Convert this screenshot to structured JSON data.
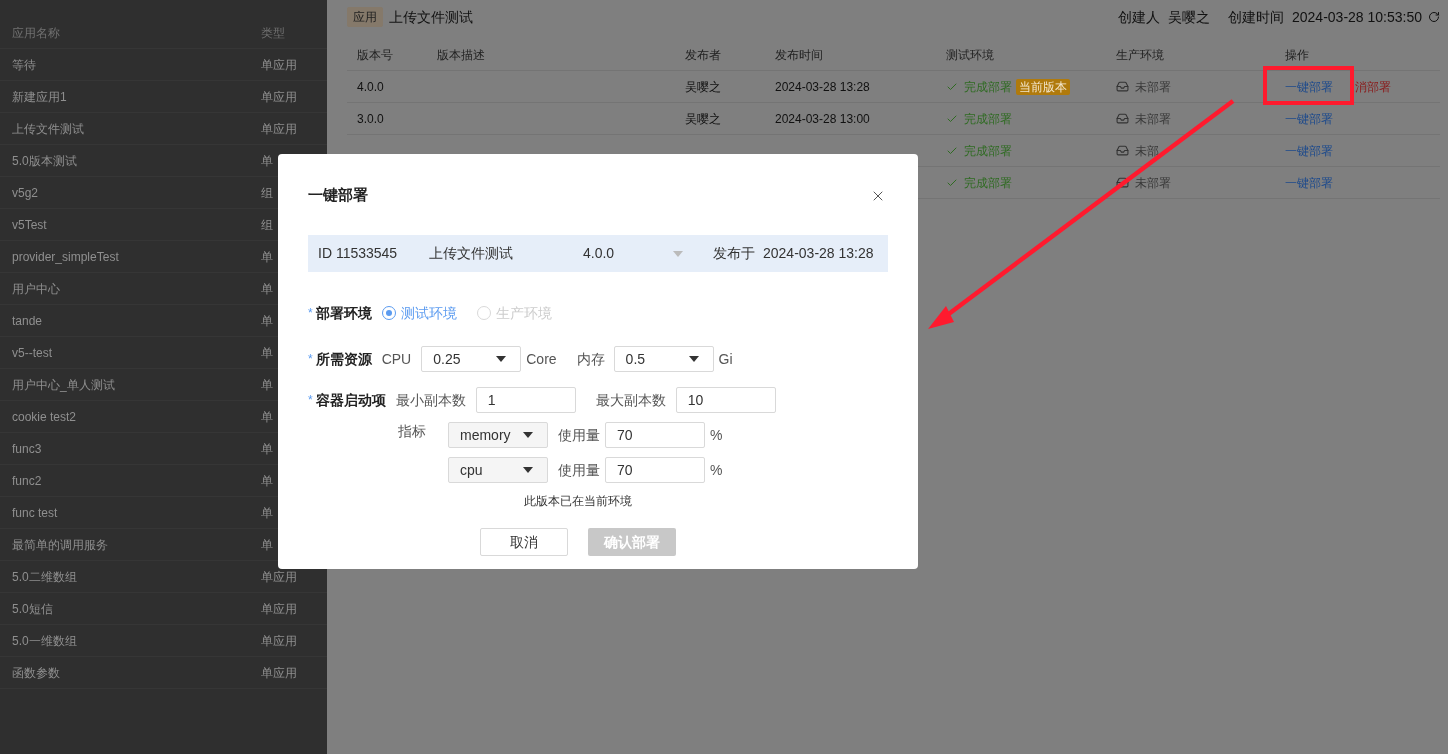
{
  "sidebar": {
    "columns": [
      "应用名称",
      "类型"
    ],
    "rows": [
      {
        "name": "等待",
        "type": "单应用"
      },
      {
        "name": "新建应用1",
        "type": "单应用"
      },
      {
        "name": "上传文件测试",
        "type": "单应用"
      },
      {
        "name": "5.0版本测试",
        "type": "单"
      },
      {
        "name": "v5g2",
        "type": "组"
      },
      {
        "name": "v5Test",
        "type": "组"
      },
      {
        "name": "provider_simpleTest",
        "type": "单"
      },
      {
        "name": "用户中心",
        "type": "单"
      },
      {
        "name": "tande",
        "type": "单"
      },
      {
        "name": "v5--test",
        "type": "单"
      },
      {
        "name": "用户中心_单人测试",
        "type": "单"
      },
      {
        "name": "cookie test2",
        "type": "单"
      },
      {
        "name": "func3",
        "type": "单"
      },
      {
        "name": "func2",
        "type": "单"
      },
      {
        "name": "func test",
        "type": "单"
      },
      {
        "name": "最简单的调用服务",
        "type": "单"
      },
      {
        "name": "5.0二维数组",
        "type": "单应用"
      },
      {
        "name": "5.0短信",
        "type": "单应用"
      },
      {
        "name": "5.0一维数组",
        "type": "单应用"
      },
      {
        "name": "函数参数",
        "type": "单应用"
      }
    ]
  },
  "header": {
    "tag": "应用",
    "title": "上传文件测试",
    "creator_label": "创建人",
    "creator": "吴嘤之",
    "created_label": "创建时间",
    "created_time": "2024-03-28 10:53:50"
  },
  "table": {
    "columns": [
      "版本号",
      "版本描述",
      "发布者",
      "发布时间",
      "测试环境",
      "生产环境",
      "操作"
    ],
    "rows": [
      {
        "version": "4.0.0",
        "publisher": "吴嘤之",
        "time": "2024-03-28 13:28",
        "test_env": "完成部署",
        "current_tag": "当前版本",
        "prod_env": "未部署",
        "actions": [
          {
            "label": "一键部署",
            "kind": "link"
          },
          {
            "label": "消部署",
            "kind": "danger"
          }
        ]
      },
      {
        "version": "3.0.0",
        "publisher": "吴嘤之",
        "time": "2024-03-28 13:00",
        "test_env": "完成部署",
        "prod_env": "未部署",
        "actions": [
          {
            "label": "一键部署",
            "kind": "link"
          }
        ]
      },
      {
        "test_env": "完成部署",
        "prod_env": "未部",
        "actions": [
          {
            "label": "一键部署",
            "kind": "link"
          }
        ]
      },
      {
        "test_env": "完成部署",
        "prod_env": "未部署",
        "actions": [
          {
            "label": "一键部署",
            "kind": "link"
          }
        ]
      }
    ]
  },
  "dialog": {
    "title": "一键部署",
    "info": {
      "id": "ID 11533545",
      "app": "上传文件测试",
      "version": "4.0.0",
      "published_label": "发布于",
      "published_time": "2024-03-28 13:28"
    },
    "environment": {
      "required_mark": "*",
      "label": "部署环境",
      "options": [
        {
          "label": "测试环境",
          "selected": true,
          "disabled": false
        },
        {
          "label": "生产环境",
          "selected": false,
          "disabled": true
        }
      ]
    },
    "resources": {
      "required_mark": "*",
      "label": "所需资源",
      "cpu_label": "CPU",
      "cpu_value": "0.25",
      "cpu_unit": "Core",
      "memory_label": "内存",
      "memory_value": "0.5",
      "memory_unit": "Gi"
    },
    "container": {
      "required_mark": "*",
      "label": "容器启动项",
      "min_label": "最小副本数",
      "min_value": "1",
      "max_label": "最大副本数",
      "max_value": "10",
      "metrics_label": "指标",
      "metrics": [
        {
          "metric": "memory",
          "usage_label": "使用量",
          "value": "70",
          "unit": "%"
        },
        {
          "metric": "cpu",
          "usage_label": "使用量",
          "value": "70",
          "unit": "%"
        }
      ]
    },
    "note": "此版本已在当前环境",
    "buttons": [
      {
        "label": "取消",
        "kind": "secondary",
        "disabled": false
      },
      {
        "label": "确认部署",
        "kind": "primary",
        "disabled": true
      }
    ]
  }
}
